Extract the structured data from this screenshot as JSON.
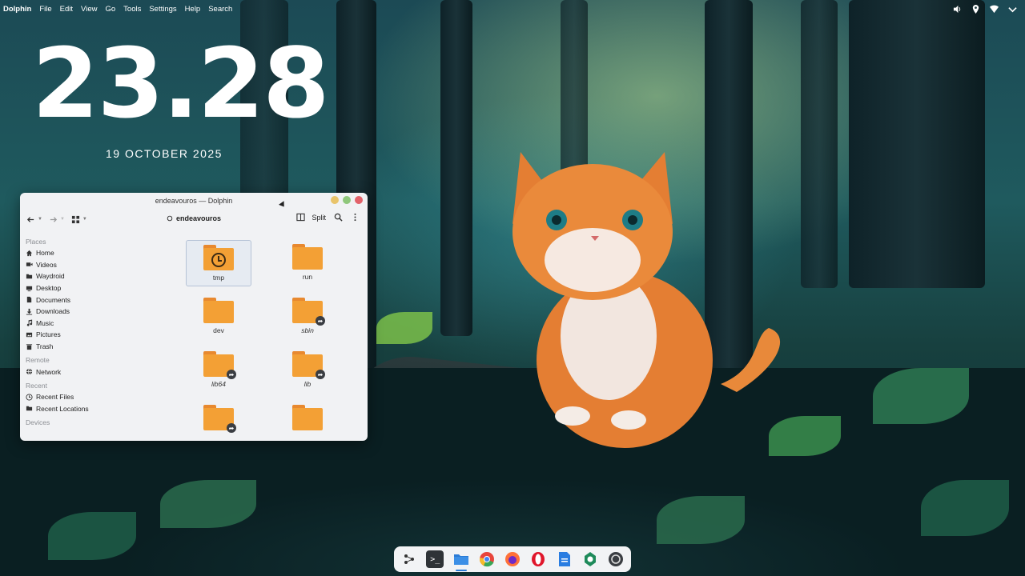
{
  "topbar": {
    "app_name": "Dolphin",
    "menu": [
      "File",
      "Edit",
      "View",
      "Go",
      "Tools",
      "Settings",
      "Help",
      "Search"
    ],
    "tray_icons": [
      "volume-icon",
      "location-icon",
      "wifi-icon",
      "chevron-down-icon"
    ]
  },
  "desktop": {
    "clock": "23.28",
    "date": "19 OCTOBER 2025"
  },
  "window": {
    "title": "endeavouros — Dolphin",
    "location": "endeavouros",
    "split_label": "Split",
    "controls": {
      "minimize_color": "#e9c46a",
      "maximize_color": "#8fc77b",
      "close_color": "#e2626a"
    }
  },
  "sidebar": {
    "places_title": "Places",
    "places": [
      {
        "label": "Home",
        "icon": "home-icon"
      },
      {
        "label": "Videos",
        "icon": "video-icon"
      },
      {
        "label": "Waydroid",
        "icon": "folder-icon"
      },
      {
        "label": "Desktop",
        "icon": "desktop-icon"
      },
      {
        "label": "Documents",
        "icon": "document-icon"
      },
      {
        "label": "Downloads",
        "icon": "download-icon"
      },
      {
        "label": "Music",
        "icon": "music-icon"
      },
      {
        "label": "Pictures",
        "icon": "picture-icon"
      },
      {
        "label": "Trash",
        "icon": "trash-icon"
      }
    ],
    "remote_title": "Remote",
    "remote": [
      {
        "label": "Network",
        "icon": "network-icon"
      }
    ],
    "recent_title": "Recent",
    "recent": [
      {
        "label": "Recent Files",
        "icon": "clock-icon"
      },
      {
        "label": "Recent Locations",
        "icon": "location-history-icon"
      }
    ],
    "devices_title": "Devices"
  },
  "files": [
    {
      "name": "tmp",
      "link": false,
      "emblem": "clock",
      "selected": true
    },
    {
      "name": "run",
      "link": false,
      "emblem": "",
      "selected": false
    },
    {
      "name": "dev",
      "link": false,
      "emblem": "",
      "selected": false
    },
    {
      "name": "sbin",
      "link": true,
      "emblem": "link",
      "selected": false
    },
    {
      "name": "lib64",
      "link": true,
      "emblem": "link",
      "selected": false
    },
    {
      "name": "lib",
      "link": true,
      "emblem": "link",
      "selected": false
    },
    {
      "name": "",
      "link": true,
      "emblem": "link",
      "selected": false
    },
    {
      "name": "",
      "link": false,
      "emblem": "",
      "selected": false
    }
  ],
  "dock": {
    "items": [
      "app-launcher-icon",
      "terminal-icon",
      "file-manager-icon",
      "chrome-icon",
      "firefox-icon",
      "opera-icon",
      "docs-icon",
      "settings-gear-icon",
      "system-settings-icon"
    ],
    "active": "file-manager-icon"
  }
}
